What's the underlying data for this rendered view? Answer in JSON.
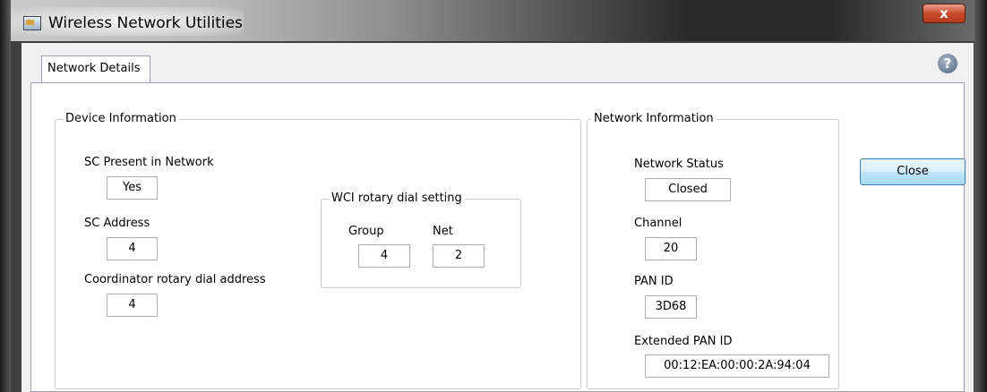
{
  "window": {
    "title": "Wireless Network Utilities",
    "close_glyph": "x"
  },
  "tabs": [
    {
      "label": "Network Details",
      "selected": true
    }
  ],
  "help": {
    "glyph": "?"
  },
  "device_info": {
    "title": "Device Information",
    "sc_present_label": "SC Present in Network",
    "sc_present_value": "Yes",
    "sc_address_label": "SC Address",
    "sc_address_value": "4",
    "coord_dial_label": "Coordinator rotary dial address",
    "coord_dial_value": "4",
    "wci": {
      "title": "WCI rotary dial setting",
      "group_label": "Group",
      "group_value": "4",
      "net_label": "Net",
      "net_value": "2"
    }
  },
  "network_info": {
    "title": "Network Information",
    "status_label": "Network Status",
    "status_value": "Closed",
    "channel_label": "Channel",
    "channel_value": "20",
    "pan_id_label": "PAN ID",
    "pan_id_value": "3D68",
    "ext_pan_id_label": "Extended PAN ID",
    "ext_pan_id_value": "00:12:EA:00:00:2A:94:04"
  },
  "buttons": {
    "close_label": "Close"
  },
  "icons": {
    "app": "network-app-icon",
    "help": "help-icon",
    "window_close": "close-icon"
  }
}
